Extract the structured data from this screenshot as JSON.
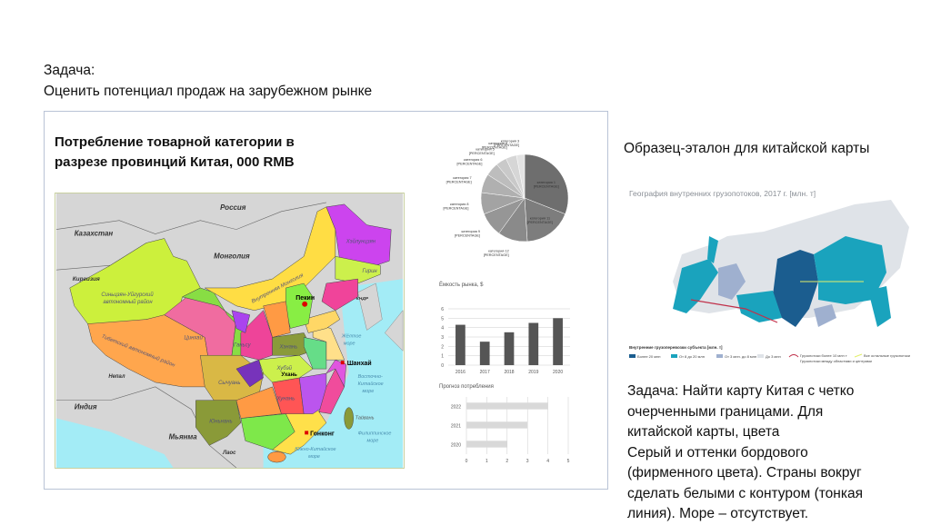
{
  "task": {
    "line1": "Задача:",
    "line2": "Оценить потенциал продаж на зарубежном рынке"
  },
  "box": {
    "title_line1": "Потребление товарной категории в",
    "title_line2": "разрезе провинций Китая, 000 RMB",
    "map": {
      "countries": {
        "russia": "Россия",
        "kazakhstan": "Казахстан",
        "mongolia": "Монголия",
        "kyrgyzstan": "Киргизия",
        "india": "Индия",
        "myanmar": "Мьянма",
        "nepal": "Непал",
        "laos": "Лаос",
        "kndr": "КНДР"
      },
      "regions": {
        "xinjiang_1": "Синьцзян-Уйгурский",
        "xinjiang_2": "автономный район",
        "tibet": "Тибетский автономный район",
        "qinghai": "Цинхай",
        "sichuan": "Сычуань",
        "inner_mongolia": "Внутренняя Монголия",
        "heilongjiang": "Хэйлунцзян",
        "jilin": "Гирин",
        "yunnan": "Юньнань",
        "gansu": "Ганьсу",
        "hubei": "Хубэй",
        "hunan": "Хунань",
        "henan": "Хэнань"
      },
      "cities": {
        "beijing": "Пекин",
        "shanghai": "Шанхай",
        "hongkong": "Гонконг",
        "wuhan": "Ухань"
      },
      "seas": {
        "east_china_1": "Восточно-",
        "east_china_2": "Китайское",
        "east_china_3": "море",
        "south_china_1": "Южно-Китайское",
        "south_china_2": "море",
        "yellow_1": "Жёлтое",
        "yellow_2": "море",
        "philippine_1": "Филиппинское",
        "philippine_2": "море"
      },
      "taiwan": "Тайвань",
      "colors": {
        "land": "#d6d6d6",
        "sea": "#a3ecf6"
      }
    }
  },
  "chart_data": [
    {
      "type": "pie",
      "slices": [
        {
          "label": "категория 1",
          "sublabel": "[PERCENTAGE]",
          "value": 31,
          "color": "#6e6e6e"
        },
        {
          "label": "категория 11",
          "sublabel": "[PERCENTAGE]",
          "value": 18,
          "color": "#7d7d7d"
        },
        {
          "label": "категория 12",
          "sublabel": "[PERCENTAGE]",
          "value": 11,
          "color": "#8a8a8a"
        },
        {
          "label": "категория 9",
          "sublabel": "[PERCENTAGE]",
          "value": 9,
          "color": "#969696"
        },
        {
          "label": "категория 8",
          "sublabel": "[PERCENTAGE]",
          "value": 8,
          "color": "#a3a3a3"
        },
        {
          "label": "категория 7",
          "sublabel": "[PERCENTAGE]",
          "value": 7,
          "color": "#b0b0b0"
        },
        {
          "label": "категория 6",
          "sublabel": "[PERCENTAGE]",
          "value": 5,
          "color": "#bdbdbd"
        },
        {
          "label": "категория 5",
          "sublabel": "[PERCENTAGE]",
          "value": 4,
          "color": "#c9c9c9"
        },
        {
          "label": "категория 4",
          "sublabel": "[PERCENTAGE]",
          "value": 4,
          "color": "#d6d6d6"
        },
        {
          "label": "категория 3",
          "sublabel": "[PERCENTAGE]",
          "value": 3,
          "color": "#e3e3e3"
        }
      ]
    },
    {
      "type": "bar",
      "title": "Ёмкость рынка, $",
      "categories": [
        "2016",
        "2017",
        "2018",
        "2019",
        "2020"
      ],
      "values": [
        4.3,
        2.5,
        3.5,
        4.5,
        5.0
      ],
      "ylim": [
        0,
        6
      ],
      "yticks": [
        "0",
        "1",
        "2",
        "3",
        "4",
        "5",
        "6"
      ],
      "grid": true,
      "color": "#555555"
    },
    {
      "type": "bar",
      "orientation": "horizontal",
      "title": "Прогноз потребления",
      "categories": [
        "2022",
        "2021",
        "2020"
      ],
      "values": [
        4,
        3,
        2
      ],
      "xlim": [
        0,
        5
      ],
      "xticks": [
        "0",
        "1",
        "2",
        "3",
        "4",
        "5"
      ],
      "grid": true,
      "color": "#d9d9d9"
    }
  ],
  "reference": {
    "title": "Образец-эталон для китайской карты",
    "map_title": "География внутренних грузопотоков, 2017 г. [млн. т]",
    "legend_title": "Внутренние грузоперевозки субъекта [млн. т]",
    "legend": [
      {
        "label": "Более 20 млн",
        "color": "#1b5d8f"
      },
      {
        "label": "От 8 до 20 млн",
        "color": "#1aa3bd"
      },
      {
        "label": "От 3 млн. до 8 млн",
        "color": "#9fb0cf"
      },
      {
        "label": "До 3 млн",
        "color": "#dfe3e8"
      }
    ],
    "flows": [
      "Грузопотоки более 10 млн т",
      "Грузопотоки между областями и центрами",
      "Все остальные грузопотоки"
    ]
  },
  "right_task": {
    "lines": [
      "Задача: Найти карту Китая с четко",
      "очерченными границами. Для",
      "китайской карты, цвета",
      "Серый и оттенки бордового",
      "(фирменного цвета). Страны вокруг",
      "сделать белыми с контуром (тонкая",
      "линия). Море – отсутствует."
    ]
  }
}
